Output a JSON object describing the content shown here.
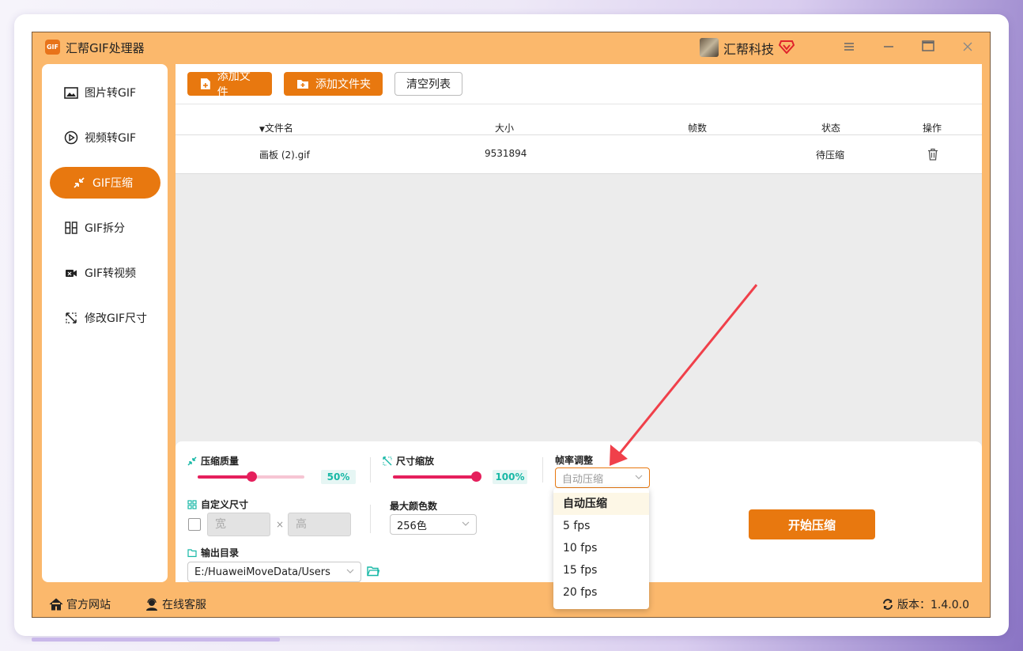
{
  "window": {
    "title": "汇帮GIF处理器",
    "logo_text": "GIF",
    "company": "汇帮科技"
  },
  "sidebar": {
    "items": [
      {
        "label": "图片转GIF",
        "icon": "image-icon"
      },
      {
        "label": "视频转GIF",
        "icon": "play-icon"
      },
      {
        "label": "GIF压缩",
        "icon": "compress-icon",
        "active": true
      },
      {
        "label": "GIF拆分",
        "icon": "split-icon"
      },
      {
        "label": "GIF转视频",
        "icon": "video-camera-icon"
      },
      {
        "label": "修改GIF尺寸",
        "icon": "resize-icon"
      }
    ]
  },
  "toolbar": {
    "add_file": "添加文件",
    "add_folder": "添加文件夹",
    "clear_list": "清空列表"
  },
  "table": {
    "columns": [
      "文件名",
      "大小",
      "帧数",
      "状态",
      "操作"
    ],
    "rows": [
      {
        "name": "画板 (2).gif",
        "size": "9531894",
        "frames": "",
        "status": "待压缩"
      }
    ]
  },
  "settings": {
    "quality": {
      "label": "压缩质量",
      "value": 50,
      "display": "50%"
    },
    "scale": {
      "label": "尺寸缩放",
      "value": 100,
      "display": "100%"
    },
    "framerate": {
      "label": "帧率调整",
      "selected": "自动压缩",
      "options": [
        "自动压缩",
        "5 fps",
        "10 fps",
        "15 fps",
        "20 fps"
      ]
    },
    "custom_size": {
      "label": "自定义尺寸",
      "width_placeholder": "宽",
      "height_placeholder": "高",
      "times": "×"
    },
    "max_colors": {
      "label": "最大颜色数",
      "selected": "256色"
    },
    "output": {
      "label": "输出目录",
      "path": "E:/HuaweiMoveData/Users"
    },
    "start_button": "开始压缩"
  },
  "footer": {
    "website": "官方网站",
    "support": "在线客服",
    "version": "版本：1.4.0.0"
  },
  "colors": {
    "accent": "#e8780f",
    "frame": "#fbb86c",
    "slider": "#e51f5c",
    "annotation": "#f0404a"
  }
}
